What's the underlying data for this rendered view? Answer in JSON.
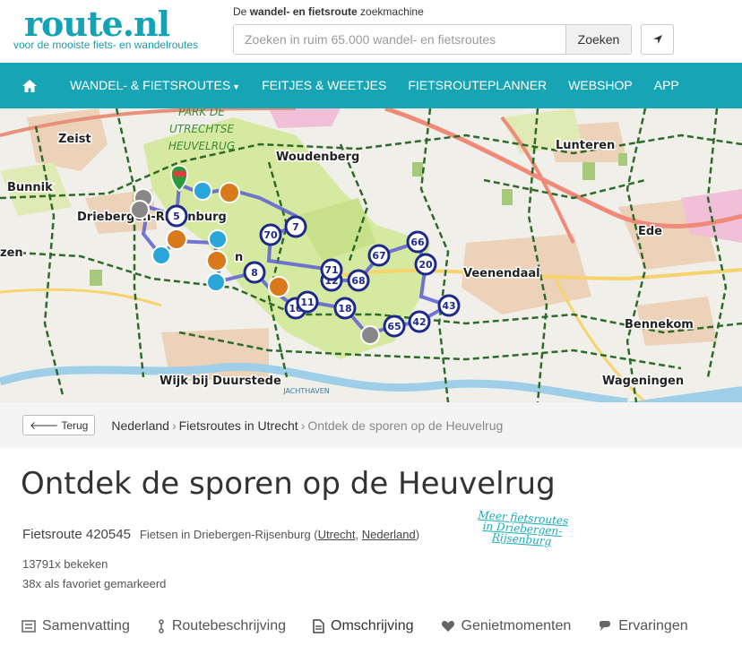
{
  "header": {
    "logo": "route.nl",
    "tagline": "voor de mooiste fiets- en wandelroutes",
    "search_caption_pre": "De ",
    "search_caption_bold": "wandel- en fietsroute",
    "search_caption_post": " zoekmachine",
    "search_placeholder": "Zoeken in ruim 65.000 wandel- en fietsroutes",
    "search_button": "Zoeken"
  },
  "nav": {
    "items": [
      {
        "label": "WANDEL- & FIETSROUTES"
      },
      {
        "label": "FEITJES & WEETJES"
      },
      {
        "label": "FIETSROUTEPLANNER"
      },
      {
        "label": "WEBSHOP"
      },
      {
        "label": "APP"
      }
    ]
  },
  "map": {
    "places": [
      "Zeist",
      "Woudenberg",
      "Lunteren",
      "Bunnik",
      "Driebergen-Rijsenburg",
      "Ede",
      "Veenendaal",
      "Bennekom",
      "Wijk bij Duurstede",
      "Wageningen",
      "zen",
      "n"
    ],
    "park_label": [
      "PARK DE",
      "UTRECHTSE",
      "HEUVELRUG"
    ],
    "water_label": "JACHTHAVEN",
    "nodes": [
      "5",
      "7",
      "70",
      "8",
      "71",
      "12",
      "68",
      "67",
      "66",
      "20",
      "11",
      "10",
      "18",
      "65",
      "42",
      "43"
    ]
  },
  "breadcrumb": {
    "back": "Terug",
    "items": [
      "Nederland",
      "Fietsroutes in Utrecht"
    ],
    "current": "Ontdek de sporen op de Heuvelrug"
  },
  "route": {
    "title": "Ontdek de sporen op de Heuvelrug",
    "id_label": "Fietsroute 420545",
    "sub_pre": "Fietsen in Driebergen-Rijsenburg (",
    "link_province": "Utrecht",
    "link_country": "Nederland",
    "views": "13791x bekeken",
    "favorites": "38x als favoriet gemarkeerd",
    "more_link": [
      "Meer fietsroutes",
      "in Driebergen-",
      "Rijsenburg"
    ]
  },
  "tabs": [
    {
      "label": "Samenvatting",
      "icon": "summary-icon"
    },
    {
      "label": "Routebeschrijving",
      "icon": "route-icon"
    },
    {
      "label": "Omschrijving",
      "icon": "document-icon"
    },
    {
      "label": "Genietmomenten",
      "icon": "heart-icon"
    },
    {
      "label": "Ervaringen",
      "icon": "comment-icon"
    }
  ],
  "colors": {
    "brand": "#17a5b6",
    "route_line": "#5a5fd0",
    "node_border": "#1e2a8a",
    "forest": "#d6e9a0",
    "network": "#2e6b2a"
  }
}
